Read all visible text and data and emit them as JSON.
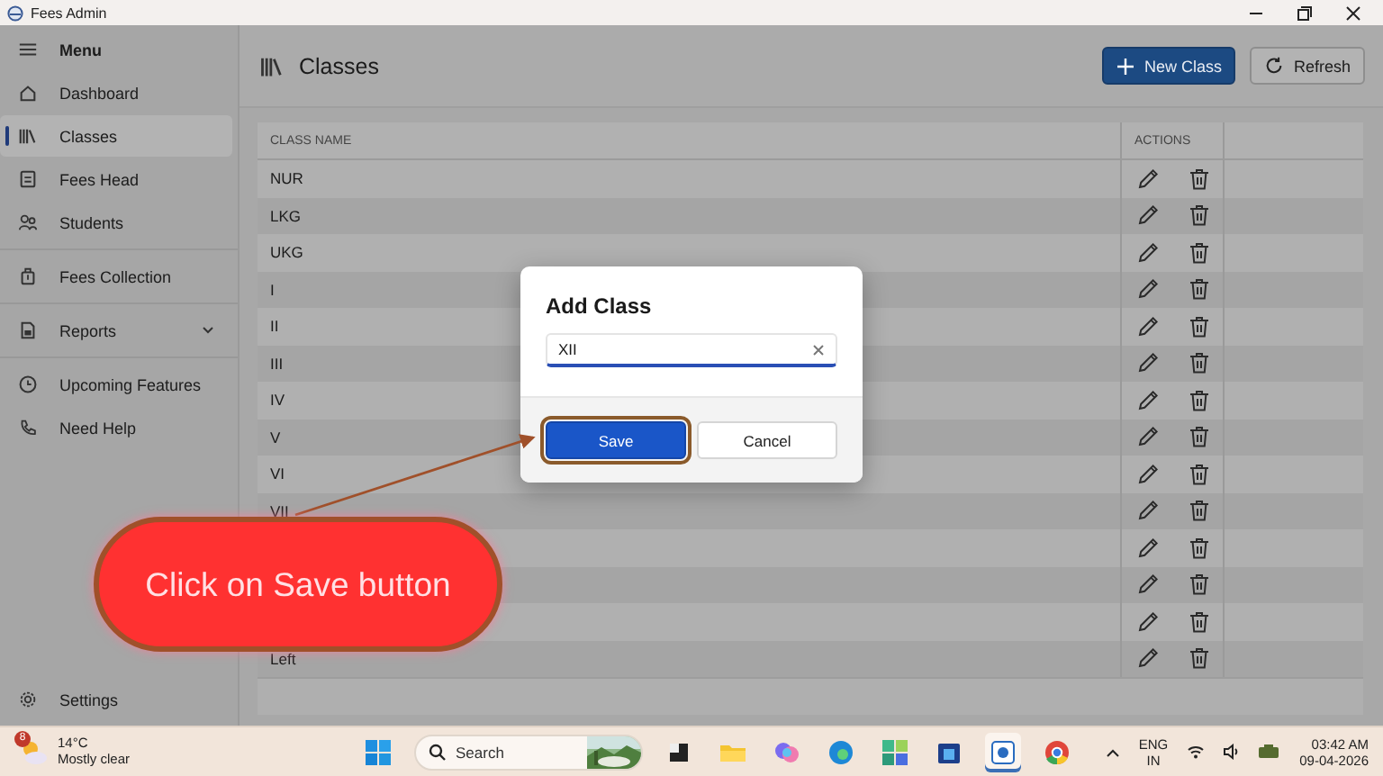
{
  "window": {
    "title": "Fees Admin"
  },
  "sidebar": {
    "menu_label": "Menu",
    "items": [
      {
        "label": "Dashboard",
        "selected": false
      },
      {
        "label": "Classes",
        "selected": true
      },
      {
        "label": "Fees Head",
        "selected": false
      },
      {
        "label": "Students",
        "selected": false
      },
      {
        "label": "Fees Collection",
        "selected": false,
        "section_start": true
      },
      {
        "label": "Reports",
        "selected": false,
        "section_start": true,
        "expandable": true
      },
      {
        "label": "Upcoming Features",
        "selected": false,
        "section_start": true
      },
      {
        "label": "Need Help",
        "selected": false
      }
    ],
    "footer": {
      "label": "Settings"
    }
  },
  "page": {
    "title": "Classes",
    "buttons": [
      {
        "label": "New Class",
        "kind": "primary"
      },
      {
        "label": "Refresh",
        "kind": "secondary"
      }
    ]
  },
  "table": {
    "columns": [
      "CLASS NAME",
      "ACTIONS"
    ],
    "rows": [
      {
        "name": "NUR"
      },
      {
        "name": "LKG"
      },
      {
        "name": "UKG"
      },
      {
        "name": "I"
      },
      {
        "name": "II"
      },
      {
        "name": "III"
      },
      {
        "name": "IV"
      },
      {
        "name": "V"
      },
      {
        "name": "VI"
      },
      {
        "name": "VII"
      },
      {},
      {},
      {},
      {
        "name": "Left"
      }
    ]
  },
  "dialog": {
    "title": "Add Class",
    "field": {
      "value": "XII"
    },
    "buttons": [
      {
        "label": "Save",
        "kind": "primary",
        "highlighted": true
      },
      {
        "label": "Cancel",
        "kind": "secondary",
        "highlighted": false
      }
    ]
  },
  "callout": {
    "text": "Click on Save button"
  },
  "taskbar": {
    "weather": {
      "badge": "8",
      "temperature": "14°C",
      "condition": "Mostly clear"
    },
    "search": {
      "placeholder": "Search"
    },
    "language": [
      "ENG",
      "IN"
    ],
    "time": "03:42 AM",
    "date": "09-04-2026"
  }
}
